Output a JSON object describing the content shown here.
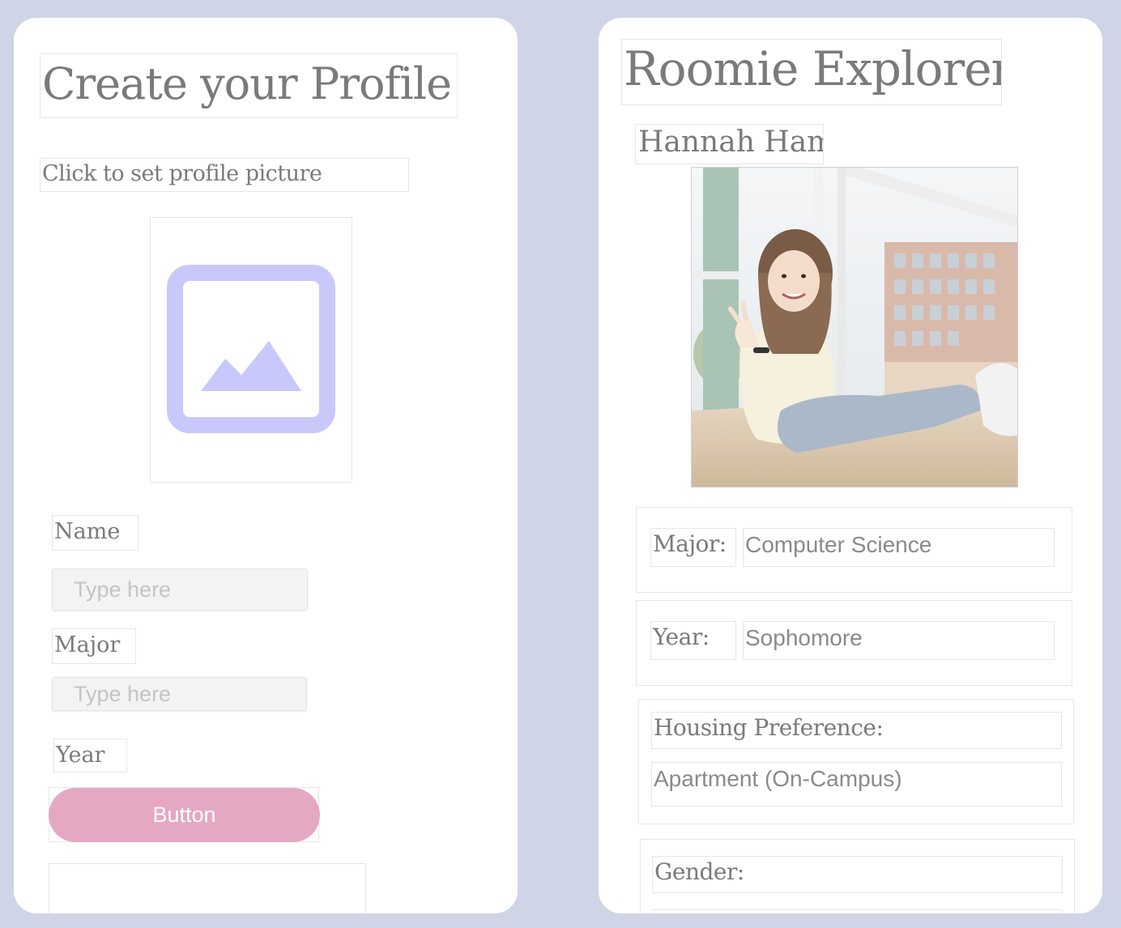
{
  "profile_form": {
    "title": "Create your Profile",
    "picture_caption": "Click to set profile picture",
    "picture_icon": "image-placeholder-icon",
    "fields": {
      "name": {
        "label": "Name",
        "placeholder": "Type here"
      },
      "major": {
        "label": "Major",
        "placeholder": "Type here"
      },
      "year": {
        "label": "Year"
      }
    },
    "submit_label": "Button"
  },
  "explorer": {
    "title": "Roomie Explorer",
    "profile": {
      "name": "Hannah Ham",
      "major_label": "Major:",
      "major_value": "Computer Science",
      "year_label": "Year:",
      "year_value": "Sophomore",
      "housing_label": "Housing Preference:",
      "housing_value": "Apartment (On-Campus)",
      "gender_label": "Gender:"
    }
  },
  "colors": {
    "background": "#cfd5e6",
    "card": "#ffffff",
    "button": "#e5a8c3",
    "icon": "#c9c8fb",
    "text": "#7a7a7a"
  }
}
